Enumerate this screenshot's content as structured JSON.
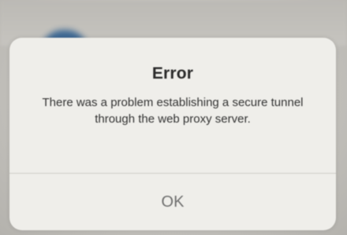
{
  "alert": {
    "title": "Error",
    "message": "There was a problem establishing a secure tunnel through the web proxy server.",
    "ok_label": "OK"
  },
  "colors": {
    "alert_background": "#efeeea",
    "button_text": "#6f6f6f",
    "title_text": "#2a2a2a"
  }
}
